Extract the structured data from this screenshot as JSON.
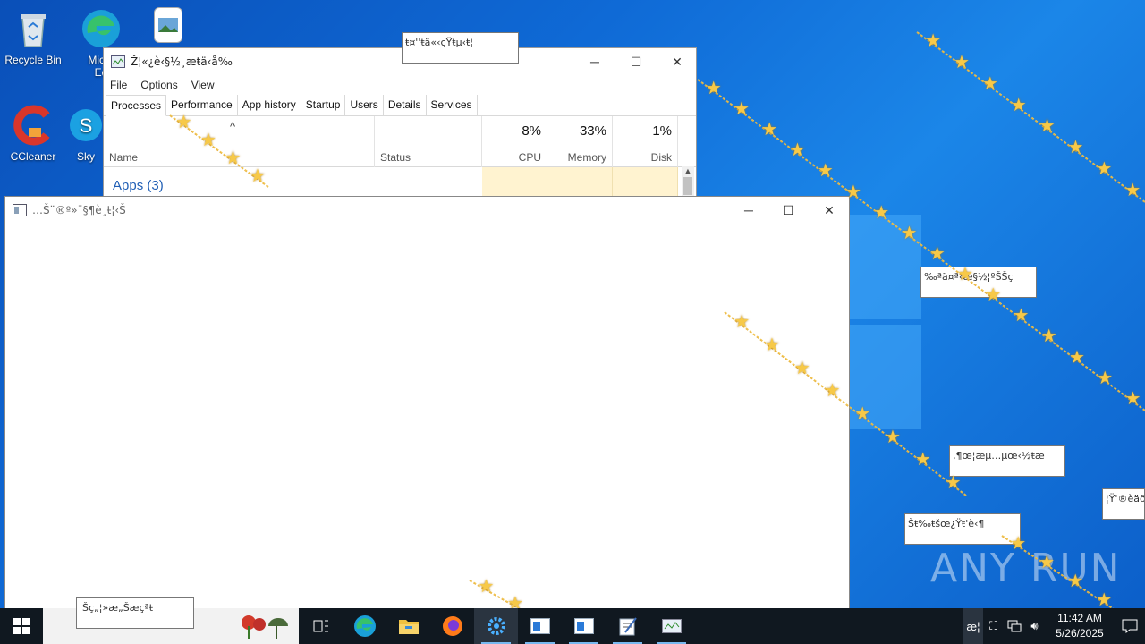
{
  "desktop": {
    "icons": [
      {
        "label": "Recycle Bin",
        "icon": "recycle-bin-icon"
      },
      {
        "label": "Micro",
        "icon": "edge-icon",
        "label2": "Ed"
      },
      {
        "label": "CCleaner",
        "icon": "ccleaner-icon"
      },
      {
        "label": "Sky",
        "icon": "skype-icon"
      }
    ],
    "watermark": "ANY RUN"
  },
  "popups": [
    "ŧ¤''ŧä«‹çŸŧµ‹ŧ¦",
    "‰ªä¤ª‹œ§½¦ºŠŠç",
    "‚¶œ¦æµ…µœ‹½ŧæ",
    "¦Ÿ'®èäð",
    "Šŧ‰ŧšœ¿Ÿŧ'è‹¶",
    "'Šç„¦»æ„Šæçªŧ"
  ],
  "task_manager": {
    "title": "Ž¦«¿è‹§½¸æŧä‹å‰",
    "menu": [
      "File",
      "Options",
      "View"
    ],
    "tabs": [
      "Processes",
      "Performance",
      "App history",
      "Startup",
      "Users",
      "Details",
      "Services"
    ],
    "active_tab": "Processes",
    "columns": {
      "name": "Name",
      "status": "Status",
      "cpu_pct": "8%",
      "cpu": "CPU",
      "mem_pct": "33%",
      "mem": "Memory",
      "disk_pct": "1%",
      "disk": "Disk"
    },
    "group": "Apps (3)"
  },
  "console_window": {
    "title": "…Š¨®º»¯§¶è¸ŧ¦‹Š"
  },
  "taskbar": {
    "clock_time": "11:42 AM",
    "clock_date": "5/26/2025",
    "tray_lang": "æ¦"
  }
}
